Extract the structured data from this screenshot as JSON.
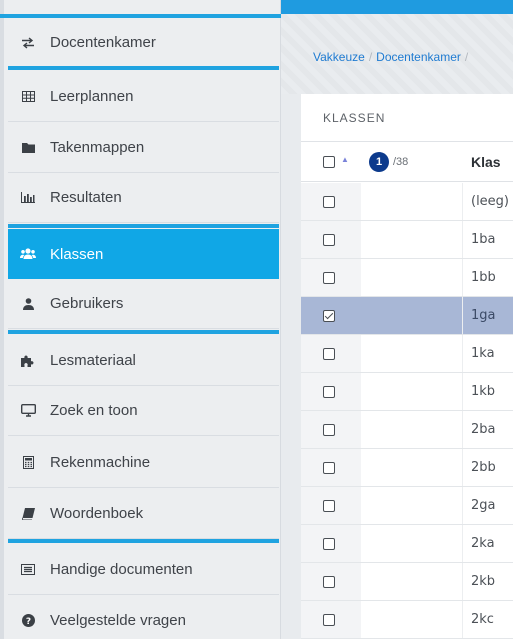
{
  "sidebar": {
    "items": [
      {
        "label": "Docentenkamer",
        "icon": "swap-arrows-icon"
      },
      {
        "label": "Leerplannen",
        "icon": "grid-table-icon"
      },
      {
        "label": "Takenmappen",
        "icon": "folder-icon"
      },
      {
        "label": "Resultaten",
        "icon": "bar-chart-icon"
      },
      {
        "label": "Klassen",
        "icon": "users-icon",
        "active": true
      },
      {
        "label": "Gebruikers",
        "icon": "user-icon"
      },
      {
        "label": "Lesmateriaal",
        "icon": "puzzle-icon"
      },
      {
        "label": "Zoek en toon",
        "icon": "monitor-icon"
      },
      {
        "label": "Rekenmachine",
        "icon": "calculator-icon"
      },
      {
        "label": "Woordenboek",
        "icon": "book-icon"
      },
      {
        "label": "Handige documenten",
        "icon": "document-list-icon"
      },
      {
        "label": "Veelgestelde vragen",
        "icon": "question-circle-icon"
      }
    ]
  },
  "breadcrumb": {
    "items": [
      "Vakkeuze",
      "Docentenkamer"
    ],
    "separator": "/"
  },
  "panel": {
    "title": "KLASSEN",
    "header": {
      "selected_count": "1",
      "total": "/38",
      "column_label": "Klas"
    },
    "rows": [
      {
        "klas": "(leeg)",
        "checked": false
      },
      {
        "klas": "1ba",
        "checked": false
      },
      {
        "klas": "1bb",
        "checked": false
      },
      {
        "klas": "1ga",
        "checked": true
      },
      {
        "klas": "1ka",
        "checked": false
      },
      {
        "klas": "1kb",
        "checked": false
      },
      {
        "klas": "2ba",
        "checked": false
      },
      {
        "klas": "2bb",
        "checked": false
      },
      {
        "klas": "2ga",
        "checked": false
      },
      {
        "klas": "2ka",
        "checked": false
      },
      {
        "klas": "2kb",
        "checked": false
      },
      {
        "klas": "2kc",
        "checked": false
      }
    ]
  },
  "colors": {
    "accent": "#10a7e6",
    "selected_row": "#a8b7d6",
    "badge": "#0c3a8c"
  }
}
